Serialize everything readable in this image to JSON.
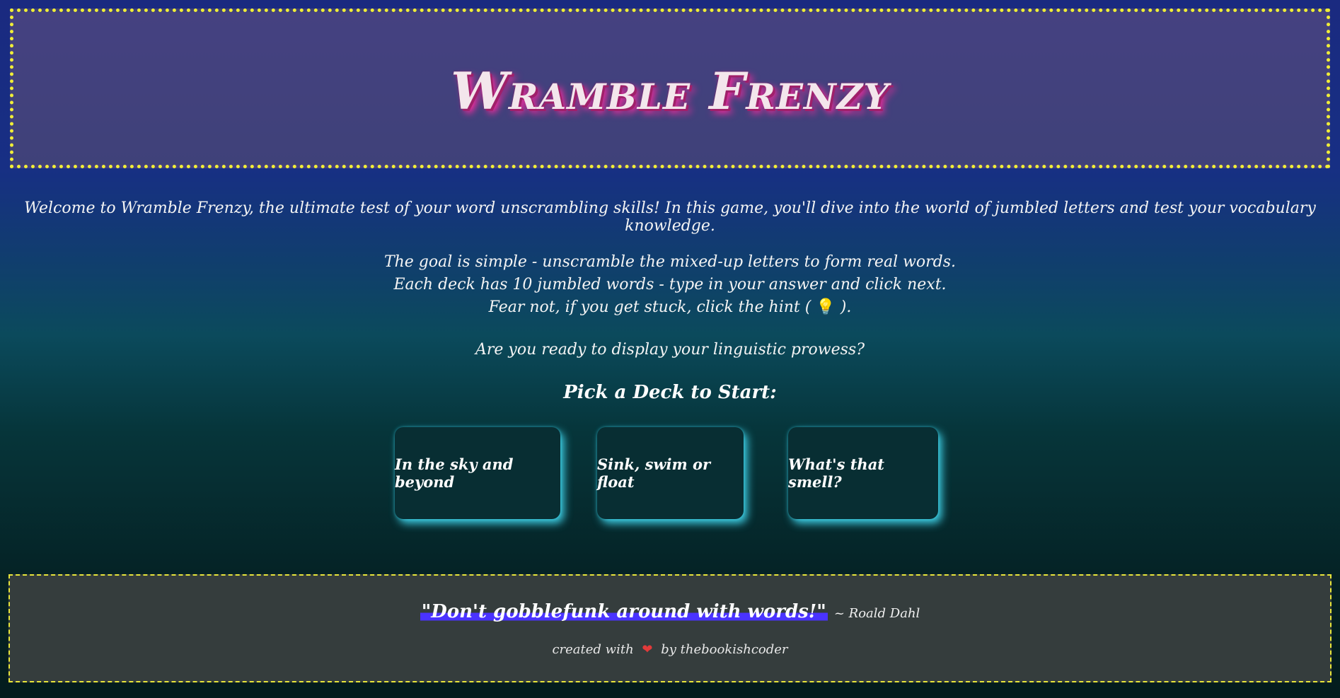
{
  "header": {
    "title": "Wramble Frenzy"
  },
  "intro": {
    "welcome": "Welcome to Wramble Frenzy, the ultimate test of your word unscrambling skills! In this game, you'll dive into the world of jumbled letters and test your vocabulary knowledge.",
    "rule_1": "The goal is simple - unscramble the mixed-up letters to form real words.",
    "rule_2": "Each deck has 10 jumbled words - type in your answer and click next.",
    "rule_3_before": "Fear not, if you get stuck, click the hint (",
    "rule_3_icon": "lightbulb-icon",
    "rule_3_after": ").",
    "ready": "Are you ready to display your linguistic prowess?",
    "pick_heading": "Pick a Deck to Start:"
  },
  "decks": [
    {
      "label": "In the sky and beyond"
    },
    {
      "label": "Sink, swim or float"
    },
    {
      "label": "What's that smell?"
    }
  ],
  "footer": {
    "quote": "\"Don't gobblefunk around with words!\"",
    "author": "~ Roald Dahl",
    "credit_before": "created with",
    "credit_icon": "heart-icon",
    "credit_after": "by thebookishcoder"
  },
  "colors": {
    "header_border": "#f1ee37",
    "deck_glow": "#3fd0e6",
    "quote_highlight": "#4a33ff",
    "heart": "#e23a3a"
  }
}
